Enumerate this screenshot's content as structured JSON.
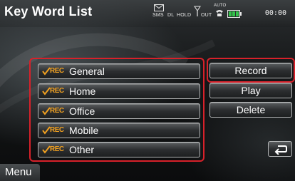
{
  "header": {
    "title": "Key Word List",
    "status": {
      "sms": "SMS",
      "dl": "DL",
      "hold": "HOLD",
      "out": "OUT",
      "auto": "AUTO"
    },
    "clock": "00:00"
  },
  "keyword_list": [
    {
      "rec_tag": "REC",
      "label": "General"
    },
    {
      "rec_tag": "REC",
      "label": "Home"
    },
    {
      "rec_tag": "REC",
      "label": "Office"
    },
    {
      "rec_tag": "REC",
      "label": "Mobile"
    },
    {
      "rec_tag": "REC",
      "label": "Other"
    }
  ],
  "actions": {
    "record": "Record",
    "play": "Play",
    "delete": "Delete"
  },
  "menu": {
    "label": "Menu"
  },
  "colors": {
    "highlight_border": "#d8212a",
    "rec_tag": "#f0a020",
    "battery": "#34c24a"
  },
  "icons": [
    "envelope-icon",
    "antenna-icon",
    "phone-handset-icon",
    "battery-icon",
    "checkbox-check-icon",
    "back-arrow-icon"
  ]
}
